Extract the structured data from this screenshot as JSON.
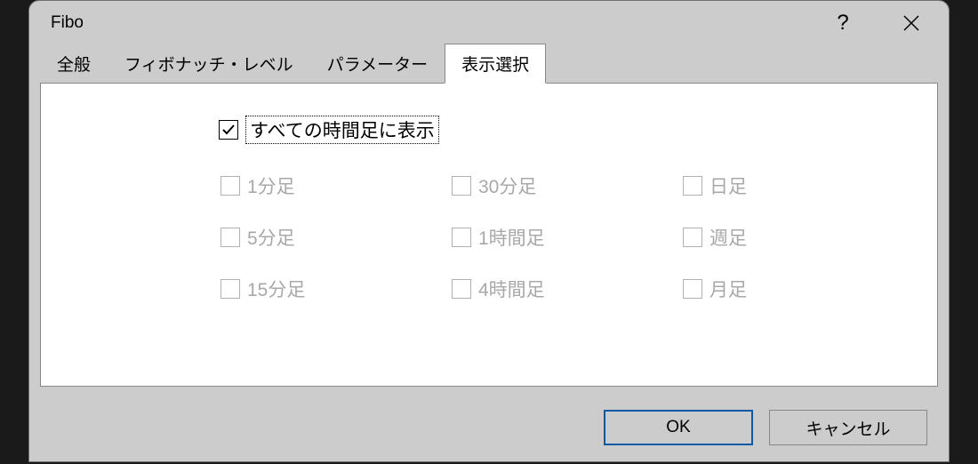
{
  "title": "Fibo",
  "tabs": [
    {
      "label": "全般",
      "active": false
    },
    {
      "label": "フィボナッチ・レベル",
      "active": false
    },
    {
      "label": "パラメーター",
      "active": false
    },
    {
      "label": "表示選択",
      "active": true
    }
  ],
  "master_checkbox": {
    "label": "すべての時間足に表示",
    "checked": true
  },
  "timeframes": {
    "col1": [
      {
        "label": "1分足"
      },
      {
        "label": "5分足"
      },
      {
        "label": "15分足"
      }
    ],
    "col2": [
      {
        "label": "30分足"
      },
      {
        "label": "1時間足"
      },
      {
        "label": "4時間足"
      }
    ],
    "col3": [
      {
        "label": "日足"
      },
      {
        "label": "週足"
      },
      {
        "label": "月足"
      }
    ]
  },
  "buttons": {
    "ok": "OK",
    "cancel": "キャンセル"
  },
  "titlebar": {
    "help": "?",
    "close": "✕"
  }
}
